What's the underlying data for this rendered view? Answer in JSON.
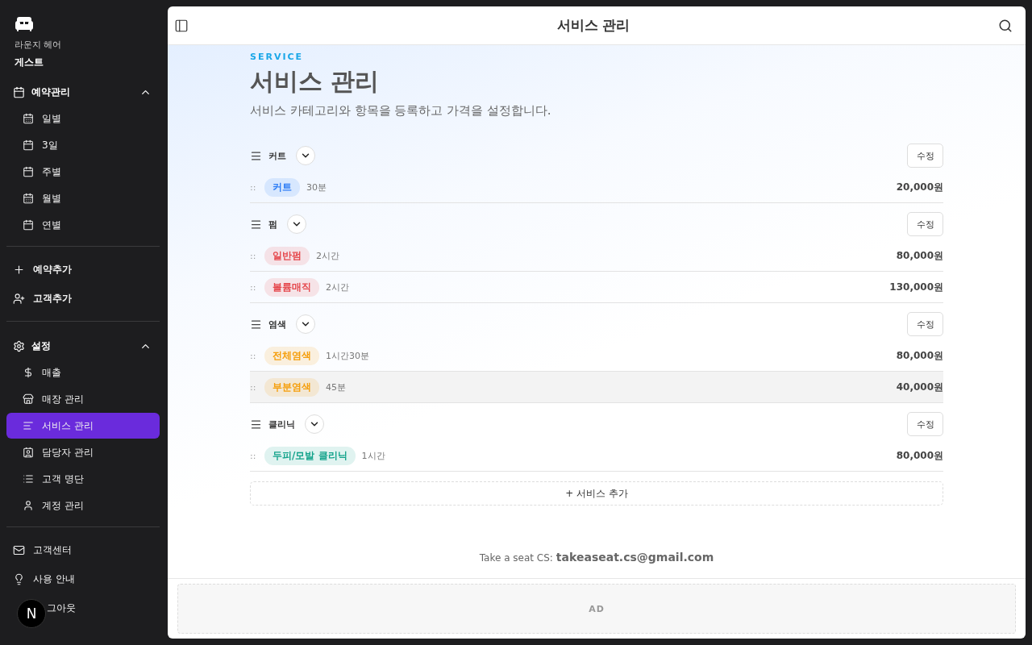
{
  "brand": {
    "store": "라운지 헤어",
    "user": "게스트"
  },
  "sidebar": {
    "groups": [
      {
        "kind": "section",
        "label": "예약관리",
        "expanded": true,
        "children": [
          {
            "label": "일별",
            "selected": false
          },
          {
            "label": "3일",
            "selected": false
          },
          {
            "label": "주별",
            "selected": false
          },
          {
            "label": "월별",
            "selected": false
          },
          {
            "label": "연별",
            "selected": false
          }
        ]
      },
      {
        "kind": "links",
        "items": [
          {
            "label": "예약추가"
          },
          {
            "label": "고객추가"
          }
        ]
      },
      {
        "kind": "section",
        "label": "설정",
        "expanded": true,
        "children": [
          {
            "label": "매출",
            "selected": false
          },
          {
            "label": "매장 관리",
            "selected": false
          },
          {
            "label": "서비스 관리",
            "selected": true
          },
          {
            "label": "담당자 관리",
            "selected": false
          },
          {
            "label": "고객 명단",
            "selected": false
          },
          {
            "label": "계정 관리",
            "selected": false
          }
        ]
      },
      {
        "kind": "links",
        "items": [
          {
            "label": "고객센터"
          },
          {
            "label": "사용 안내"
          },
          {
            "label": "그아웃"
          }
        ]
      }
    ]
  },
  "badge": "N",
  "header": {
    "title": "서비스 관리"
  },
  "page": {
    "eyebrow": "SERVICE",
    "title": "서비스 관리",
    "subtitle": "서비스 카테고리와 항목을 등록하고 가격을 설정합니다."
  },
  "categories": [
    {
      "name": "커트",
      "edit": "수정",
      "color": "#2f7ef5",
      "items": [
        {
          "name": "커트",
          "duration": "30분",
          "price": "20,000원",
          "highlighted": false
        }
      ]
    },
    {
      "name": "펌",
      "edit": "수정",
      "color": "#e5484d",
      "items": [
        {
          "name": "일반펌",
          "duration": "2시간",
          "price": "80,000원",
          "highlighted": false
        },
        {
          "name": "볼륨매직",
          "duration": "2시간",
          "price": "130,000원",
          "highlighted": false
        }
      ]
    },
    {
      "name": "염색",
      "edit": "수정",
      "color": "#f59e0b",
      "items": [
        {
          "name": "전체염색",
          "duration": "1시간30분",
          "price": "80,000원",
          "highlighted": false
        },
        {
          "name": "부분염색",
          "duration": "45분",
          "price": "40,000원",
          "highlighted": true
        }
      ]
    },
    {
      "name": "클리닉",
      "edit": "수정",
      "color": "#14a38b",
      "items": [
        {
          "name": "두피/모발 클리닉",
          "duration": "1시간",
          "price": "80,000원",
          "highlighted": false
        }
      ]
    }
  ],
  "add_button": "+ 서비스 추가",
  "drag_handle": "::",
  "footer": {
    "label": "Take a seat CS:",
    "email": "takeaseat.cs@gmail.com"
  },
  "ad": "AD"
}
